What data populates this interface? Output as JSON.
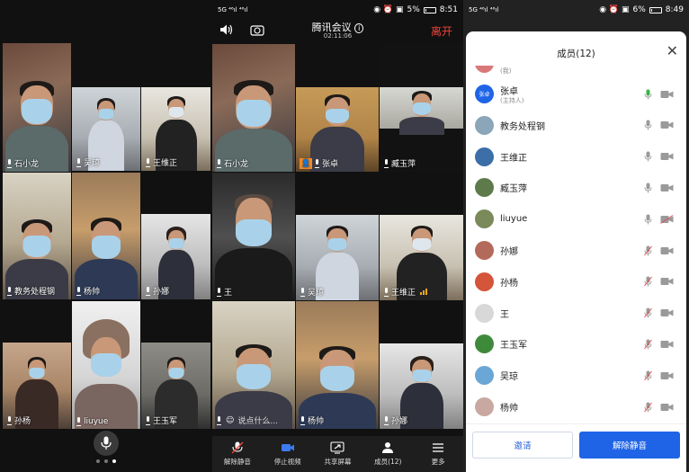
{
  "panel1": {
    "tiles": [
      {
        "name": "石小龙",
        "muted": false
      },
      {
        "name": "吴琼",
        "muted": false
      },
      {
        "name": "王维正",
        "muted": false
      },
      {
        "name": "教务处程钢",
        "muted": false
      },
      {
        "name": "杨帅",
        "muted": false
      },
      {
        "name": "孙娜",
        "muted": false
      },
      {
        "name": "孙杨",
        "muted": false
      },
      {
        "name": "liuyue",
        "muted": false
      },
      {
        "name": "王玉军",
        "muted": false
      }
    ]
  },
  "panel2": {
    "status": {
      "left": "5G ⁴⁶ıl ⁴⁶ıl",
      "battery": "5%",
      "time": "8:51"
    },
    "title": "腾讯会议",
    "timer": "02:11:06",
    "leave": "离开",
    "tiles": [
      {
        "name": "石小龙"
      },
      {
        "name": "张卓"
      },
      {
        "name": "臧玉萍"
      },
      {
        "name": "王"
      },
      {
        "name": "吴琼"
      },
      {
        "name": "王维正"
      },
      {
        "name": "说点什么..."
      },
      {
        "name": "杨帅"
      },
      {
        "name": "孙娜"
      }
    ],
    "toolbar": [
      {
        "label": "解除静音",
        "icon": "mic-off-icon"
      },
      {
        "label": "停止视频",
        "icon": "video-icon"
      },
      {
        "label": "共享屏幕",
        "icon": "share-screen-icon"
      },
      {
        "label": "成员(12)",
        "icon": "members-icon"
      },
      {
        "label": "更多",
        "icon": "more-icon"
      }
    ]
  },
  "panel3": {
    "status": {
      "battery": "6%",
      "time": "8:49"
    },
    "title": "成员(12)",
    "partial_first": "(我)",
    "members": [
      {
        "name": "张卓",
        "sub": "(主持人)",
        "avatar_text": "张卓",
        "mic": "active",
        "video": "on"
      },
      {
        "name": "教务处程钢",
        "sub": "",
        "avatar_text": "",
        "mic": "on",
        "video": "on"
      },
      {
        "name": "王维正",
        "sub": "",
        "avatar_text": "",
        "mic": "on",
        "video": "on"
      },
      {
        "name": "臧玉萍",
        "sub": "",
        "avatar_text": "",
        "mic": "on",
        "video": "on"
      },
      {
        "name": "liuyue",
        "sub": "",
        "avatar_text": "",
        "mic": "on",
        "video": "off"
      },
      {
        "name": "孙娜",
        "sub": "",
        "avatar_text": "",
        "mic": "muted",
        "video": "on"
      },
      {
        "name": "孙杨",
        "sub": "",
        "avatar_text": "",
        "mic": "muted",
        "video": "on"
      },
      {
        "name": "王",
        "sub": "",
        "avatar_text": "",
        "mic": "muted",
        "video": "on"
      },
      {
        "name": "王玉军",
        "sub": "",
        "avatar_text": "",
        "mic": "muted",
        "video": "on"
      },
      {
        "name": "吴琼",
        "sub": "",
        "avatar_text": "",
        "mic": "muted",
        "video": "on"
      },
      {
        "name": "杨帅",
        "sub": "",
        "avatar_text": "",
        "mic": "muted",
        "video": "on"
      }
    ],
    "invite": "邀请",
    "unmute_all": "解除静音"
  },
  "colors": {
    "accent_blue": "#1f64e6",
    "leave_red": "#f0433a",
    "active_green": "#2aa64a"
  }
}
